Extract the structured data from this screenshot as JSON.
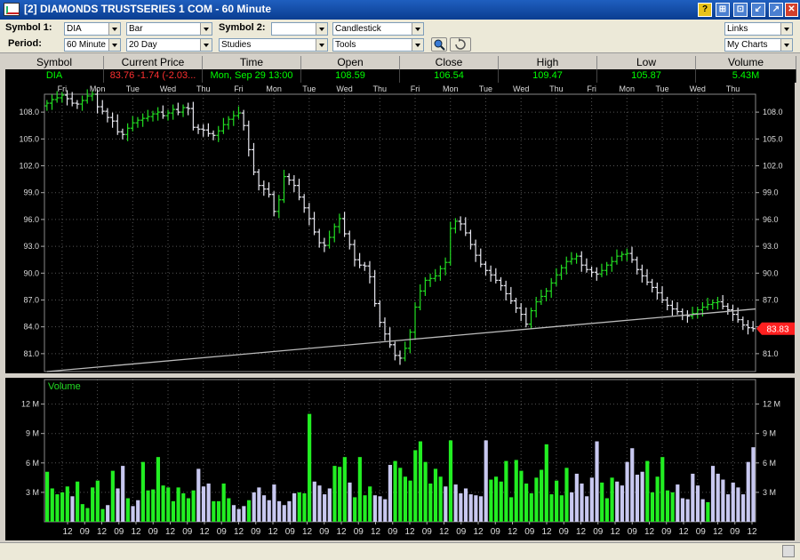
{
  "window": {
    "title": "[2] DIAMONDS TRUSTSERIES 1 COM - 60 Minute",
    "buttons": [
      "?",
      "⊞",
      "⊡",
      "↙",
      "↗",
      "✕"
    ]
  },
  "toolbar": {
    "symbol1_label": "Symbol 1:",
    "symbol1_value": "DIA",
    "chart_style": "Bar",
    "symbol2_label": "Symbol 2:",
    "symbol2_value": "",
    "symbol2_style": "Candlestick",
    "links": "Links",
    "period_label": "Period:",
    "interval": "60 Minute",
    "range": "20 Day",
    "studies": "Studies",
    "tools": "Tools",
    "my_charts": "My Charts"
  },
  "quote": {
    "headers": [
      "Symbol",
      "Current Price",
      "Time",
      "Open",
      "Close",
      "High",
      "Low",
      "Volume"
    ],
    "values": [
      "DIA",
      "83.76  -1.74 (-2.03...",
      "Mon, Sep 29  13:00",
      "108.59",
      "106.54",
      "109.47",
      "105.87",
      "5.43M"
    ],
    "colors": [
      "#00ff00",
      "#ff3030",
      "#00ff00",
      "#00ff00",
      "#00ff00",
      "#00ff00",
      "#00ff00",
      "#00ff00"
    ]
  },
  "colors": {
    "up": "#22dd22",
    "down": "#e8e8f0",
    "volume_up": "#22ee22",
    "volume_down": "#c8c8f0",
    "background": "#000000",
    "price_tag": "#ff2020"
  },
  "chart_data": [
    {
      "type": "bar",
      "title": "",
      "interval": "60 Minute",
      "ylim": [
        79.0,
        110.0
      ],
      "yticks": [
        81.0,
        84.0,
        87.0,
        90.0,
        93.0,
        96.0,
        99.0,
        102.0,
        105.0,
        108.0
      ],
      "ytick_labels": [
        "81.0",
        "84.0",
        "87.0",
        "90.0",
        "93.0",
        "96.0",
        "99.0",
        "102.0",
        "105.0",
        "108.0"
      ],
      "day_labels": [
        "Fri",
        "Mon",
        "Tue",
        "Wed",
        "Thu",
        "Fri",
        "Mon",
        "Tue",
        "Wed",
        "Thu",
        "Fri",
        "Mon",
        "Tue",
        "Wed",
        "Thu",
        "Fri",
        "Mon",
        "Tue",
        "Wed",
        "Thu"
      ],
      "current_price_tag": "83.83",
      "trendline": {
        "start": [
          0,
          79.0
        ],
        "end": [
          142,
          86.0
        ]
      },
      "grid": true,
      "closes": [
        109.0,
        109.4,
        109.6,
        109.9,
        109.5,
        109.0,
        108.9,
        109.3,
        109.8,
        110.0,
        108.6,
        108.1,
        107.4,
        107.0,
        105.8,
        105.5,
        106.2,
        106.8,
        107.1,
        107.3,
        107.5,
        107.8,
        108.0,
        107.6,
        107.9,
        108.3,
        108.0,
        108.5,
        108.4,
        106.3,
        106.1,
        106.0,
        105.6,
        105.4,
        105.9,
        106.6,
        107.2,
        107.6,
        107.9,
        106.5,
        103.8,
        101.3,
        99.8,
        99.4,
        98.8,
        96.9,
        98.2,
        100.8,
        100.4,
        99.8,
        98.5,
        97.3,
        96.1,
        94.6,
        93.4,
        93.1,
        94.0,
        95.2,
        96.1,
        94.4,
        93.2,
        91.5,
        90.9,
        90.8,
        89.6,
        86.6,
        84.5,
        83.2,
        82.0,
        80.8,
        80.5,
        81.6,
        83.4,
        86.2,
        88.0,
        89.2,
        89.4,
        89.7,
        90.5,
        91.2,
        95.0,
        95.8,
        95.5,
        94.5,
        93.2,
        92.0,
        91.0,
        90.3,
        89.8,
        89.2,
        88.6,
        87.7,
        86.9,
        86.1,
        85.4,
        84.3,
        85.8,
        86.8,
        87.4,
        88.0,
        88.9,
        89.8,
        90.6,
        91.3,
        91.6,
        91.9,
        90.9,
        90.4,
        90.1,
        89.9,
        90.3,
        90.9,
        91.3,
        91.9,
        92.1,
        92.2,
        91.5,
        90.4,
        89.7,
        89.0,
        88.4,
        87.8,
        87.0,
        86.4,
        86.0,
        85.7,
        85.3,
        85.2,
        85.5,
        85.9,
        86.2,
        86.5,
        86.7,
        86.8,
        86.3,
        85.9,
        85.4,
        84.8,
        84.2,
        83.9,
        83.8
      ],
      "volume": {
        "label": "Volume",
        "yticks": [
          3,
          6,
          9,
          12
        ],
        "ytick_labels": [
          "3 M",
          "6 M",
          "9 M",
          "12 M"
        ],
        "ylim": [
          0,
          14.5
        ],
        "x_labels": [
          "12",
          "09",
          "12",
          "09",
          "12",
          "09",
          "12",
          "09",
          "12",
          "09",
          "12",
          "09",
          "12",
          "09",
          "12",
          "09",
          "12",
          "09",
          "12",
          "09",
          "12",
          "09",
          "12",
          "09",
          "12",
          "09",
          "12",
          "09",
          "12",
          "09",
          "12",
          "09",
          "12",
          "09",
          "12",
          "09",
          "12",
          "09",
          "12",
          "09",
          "12"
        ],
        "values": [
          5.1,
          3.4,
          2.8,
          3.0,
          3.6,
          2.6,
          4.1,
          1.8,
          1.4,
          3.5,
          4.2,
          1.3,
          1.7,
          5.2,
          3.4,
          5.7,
          2.4,
          1.6,
          2.2,
          6.1,
          3.2,
          3.3,
          6.6,
          3.7,
          3.5,
          2.1,
          3.5,
          2.9,
          2.4,
          3.2,
          5.4,
          3.6,
          3.9,
          2.1,
          2.1,
          3.9,
          2.4,
          1.7,
          1.3,
          1.6,
          2.2,
          3.0,
          3.5,
          2.7,
          2.2,
          3.8,
          2.1,
          1.7,
          2.1,
          2.9,
          3.0,
          2.9,
          11.0,
          4.1,
          3.7,
          2.8,
          3.4,
          5.7,
          5.6,
          6.6,
          4.0,
          2.5,
          6.6,
          2.7,
          3.6,
          2.7,
          2.6,
          2.3,
          5.8,
          6.2,
          5.5,
          4.6,
          4.2,
          7.3,
          8.2,
          6.1,
          3.9,
          5.4,
          4.6,
          3.6,
          8.3,
          3.8,
          2.9,
          3.4,
          2.8,
          2.7,
          2.6,
          8.3,
          4.3,
          4.6,
          4.1,
          6.2,
          2.5,
          6.3,
          5.2,
          3.9,
          2.9,
          4.5,
          5.3,
          7.9,
          2.8,
          4.2,
          2.7,
          5.5,
          3.0,
          4.9,
          3.9,
          2.6,
          4.5,
          8.2,
          4.0,
          2.4,
          4.5,
          4.1,
          3.7,
          6.1,
          7.5,
          4.8,
          5.1,
          6.2,
          3.0,
          4.6,
          6.6,
          3.2,
          3.0,
          3.8,
          2.4,
          2.3,
          4.9,
          3.7,
          2.3,
          2.0,
          5.7,
          4.9,
          4.3,
          2.8,
          4.0,
          3.5,
          2.8,
          6.1,
          7.6
        ],
        "up_flags": [
          1,
          1,
          1,
          1,
          1,
          0,
          1,
          1,
          1,
          1,
          1,
          1,
          0,
          1,
          0,
          0,
          1,
          0,
          0,
          1,
          1,
          1,
          1,
          1,
          1,
          1,
          1,
          1,
          1,
          1,
          0,
          0,
          0,
          1,
          1,
          1,
          1,
          0,
          0,
          0,
          1,
          0,
          0,
          0,
          0,
          0,
          0,
          0,
          0,
          0,
          1,
          1,
          1,
          0,
          0,
          0,
          0,
          1,
          1,
          1,
          0,
          1,
          1,
          1,
          1,
          0,
          0,
          0,
          0,
          1,
          1,
          1,
          1,
          1,
          1,
          1,
          1,
          1,
          1,
          0,
          1,
          0,
          0,
          0,
          0,
          0,
          0,
          0,
          1,
          1,
          1,
          1,
          1,
          1,
          1,
          1,
          1,
          1,
          1,
          1,
          1,
          1,
          1,
          1,
          0,
          0,
          0,
          0,
          0,
          0,
          1,
          1,
          1,
          0,
          0,
          0,
          0,
          0,
          0,
          1,
          1,
          1,
          1,
          1,
          1,
          0,
          0,
          0,
          0,
          0,
          0,
          1,
          0,
          0,
          0,
          0,
          0,
          0,
          0,
          0,
          0,
          0,
          0
        ]
      }
    }
  ]
}
